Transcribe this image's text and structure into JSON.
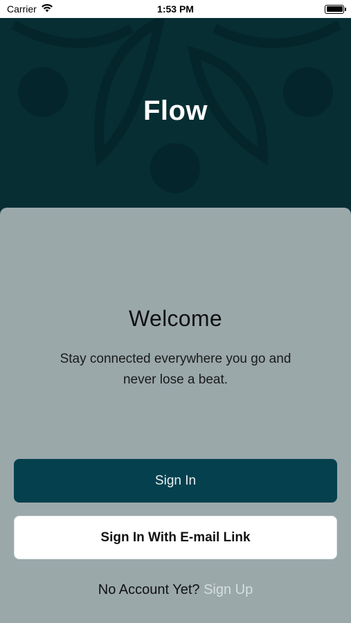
{
  "status_bar": {
    "carrier": "Carrier",
    "time": "1:53 PM",
    "icons": [
      "wifi-icon",
      "battery-icon"
    ]
  },
  "hero": {
    "title": "Flow"
  },
  "welcome": {
    "title": "Welcome",
    "line1": "Stay connected everywhere you go and",
    "line2": "never lose a beat."
  },
  "buttons": {
    "sign_in": "Sign In",
    "sign_in_email": "Sign In With E-mail Link"
  },
  "signup": {
    "prompt": "No Account Yet?",
    "link": "Sign Up"
  },
  "colors": {
    "hero_background": "#072e33",
    "card_background": "#9aa8aa",
    "primary_button": "#05404e",
    "secondary_button": "#ffffff",
    "link": "#d6dfe0"
  }
}
